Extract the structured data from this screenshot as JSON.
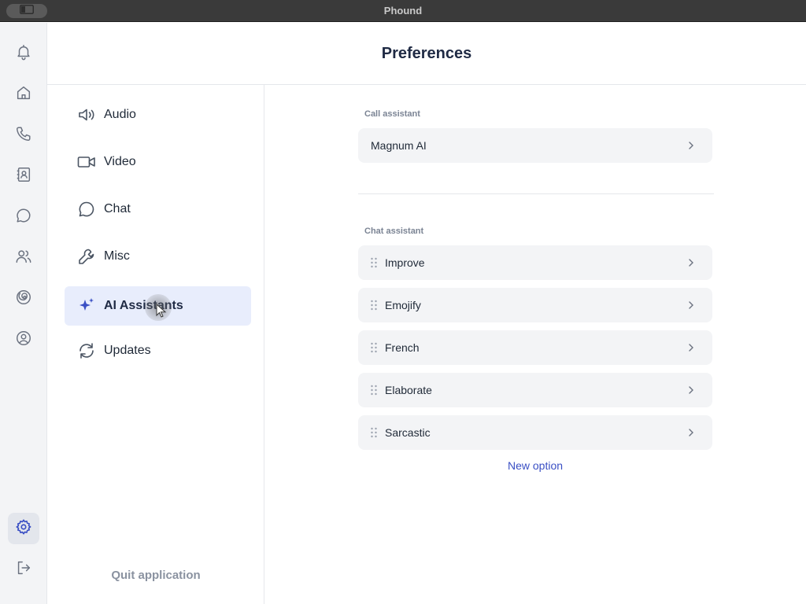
{
  "window": {
    "title": "Phound"
  },
  "rail": {
    "items": [
      {
        "icon": "bell-icon"
      },
      {
        "icon": "home-icon"
      },
      {
        "icon": "phone-icon"
      },
      {
        "icon": "contacts-book-icon"
      },
      {
        "icon": "chat-bubble-icon"
      },
      {
        "icon": "people-icon"
      },
      {
        "icon": "spiral-icon"
      },
      {
        "icon": "user-circle-icon"
      },
      {
        "icon": "gear-icon",
        "active": true
      },
      {
        "icon": "logout-icon"
      }
    ]
  },
  "header": {
    "title": "Preferences"
  },
  "nav": {
    "items": [
      {
        "label": "Audio",
        "icon": "speaker-icon"
      },
      {
        "label": "Video",
        "icon": "video-camera-icon"
      },
      {
        "label": "Chat",
        "icon": "chat-bubble-icon"
      },
      {
        "label": "Misc",
        "icon": "wrench-icon"
      },
      {
        "label": "AI Assistants",
        "icon": "sparkle-icon",
        "active": true
      },
      {
        "label": "Updates",
        "icon": "refresh-icon"
      }
    ],
    "quit_label": "Quit application"
  },
  "content": {
    "call_assistant": {
      "label": "Call assistant",
      "items": [
        {
          "label": "Magnum AI"
        }
      ]
    },
    "chat_assistant": {
      "label": "Chat assistant",
      "items": [
        {
          "label": "Improve"
        },
        {
          "label": "Emojify"
        },
        {
          "label": "French"
        },
        {
          "label": "Elaborate"
        },
        {
          "label": "Sarcastic"
        }
      ]
    },
    "new_option_label": "New option"
  },
  "colors": {
    "accent": "#3a4fc4",
    "active_nav_bg": "#e8edfc",
    "row_bg": "#f3f4f6",
    "titlebar_bg": "#3a3a3a"
  }
}
